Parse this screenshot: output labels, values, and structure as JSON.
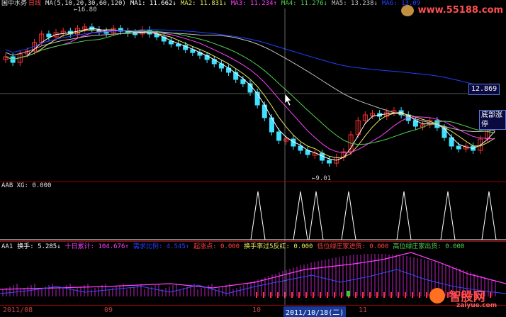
{
  "header": {
    "stock_name": "国中水务",
    "period": "日线",
    "ma_params": "MA(5,10,20,30,60,120)",
    "ma1": "MA1: 11.662↓",
    "ma2": "MA2: 11.831↓",
    "ma3": "MA3: 11.234↑",
    "ma4": "MA4: 11.276↓",
    "ma5": "MA5: 13.238↓",
    "ma6": "MA6: 13.09"
  },
  "price_panel": {
    "high_label": "16.80",
    "low_label": "9.01",
    "current_price": "12.869",
    "signal_tag": "底部涨停"
  },
  "xg_panel": {
    "title": "AAB XG: 0.000"
  },
  "turnover_panel": {
    "prefix": "AA1",
    "huanshou": "换手: 5.285↓",
    "shiri": "十日累计: 104.676↑",
    "xuqiu": "需求比例: 4.545↑",
    "qizhang": "起涨点: 0.000",
    "huanshou5": "换手率过5反红: 0.000",
    "dijin": "低位绿庄家进货: 0.000",
    "gaochu": "高位绿庄家出货: 0.000"
  },
  "date_axis": {
    "d1": "2011/08",
    "d2": "09",
    "d3": "10",
    "selected": "2011/10/18(二)",
    "d4": "11"
  },
  "watermarks": {
    "top_url": "www.55188.com",
    "bottom_brand": "智股网",
    "bottom_url": "zaiyue.com"
  },
  "colors": {
    "ma5": "#ffffff",
    "ma10": "#e8e860",
    "ma20": "#ff40ff",
    "ma30": "#50d050",
    "ma60": "#c0c0c0",
    "ma120": "#2040ff",
    "up": "#ff3030",
    "down": "#40e0ff"
  }
}
